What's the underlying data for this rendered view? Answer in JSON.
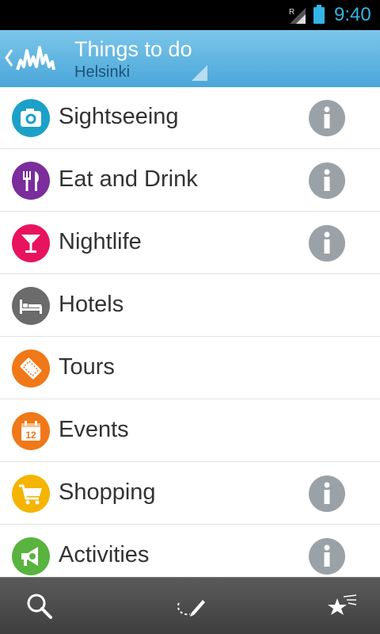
{
  "status_bar": {
    "time": "9:40",
    "roaming_indicator": "R",
    "icons": [
      "signal-icon",
      "battery-icon"
    ],
    "accent_color": "#33b5e5"
  },
  "action_bar": {
    "title": "Things to do",
    "subtitle": "Helsinki",
    "icons": [
      "back-chevron-icon",
      "app-logo-icon",
      "dropdown-corner-icon"
    ],
    "background_color": "#5bb1e0"
  },
  "categories": [
    {
      "label": "Sightseeing",
      "icon": "camera-icon",
      "color": "#1ba1c8",
      "has_info": true
    },
    {
      "label": "Eat and Drink",
      "icon": "fork-knife-icon",
      "color": "#7b2d9c",
      "has_info": true
    },
    {
      "label": "Nightlife",
      "icon": "cocktail-icon",
      "color": "#e8135e",
      "has_info": true
    },
    {
      "label": "Hotels",
      "icon": "bed-icon",
      "color": "#6b6b6b",
      "has_info": false
    },
    {
      "label": "Tours",
      "icon": "ticket-icon",
      "color": "#f07818",
      "has_info": false
    },
    {
      "label": "Events",
      "icon": "calendar-icon",
      "color": "#f07818",
      "calendar_day": "12",
      "has_info": false
    },
    {
      "label": "Shopping",
      "icon": "cart-icon",
      "color": "#f5b400",
      "has_info": true
    },
    {
      "label": "Activities",
      "icon": "megaphone-icon",
      "color": "#59b33f",
      "has_info": true
    }
  ],
  "info_icon": "info-icon",
  "bottom_bar": {
    "items": [
      "search-icon",
      "route-pencil-icon",
      "favorites-stars-icon"
    ]
  }
}
